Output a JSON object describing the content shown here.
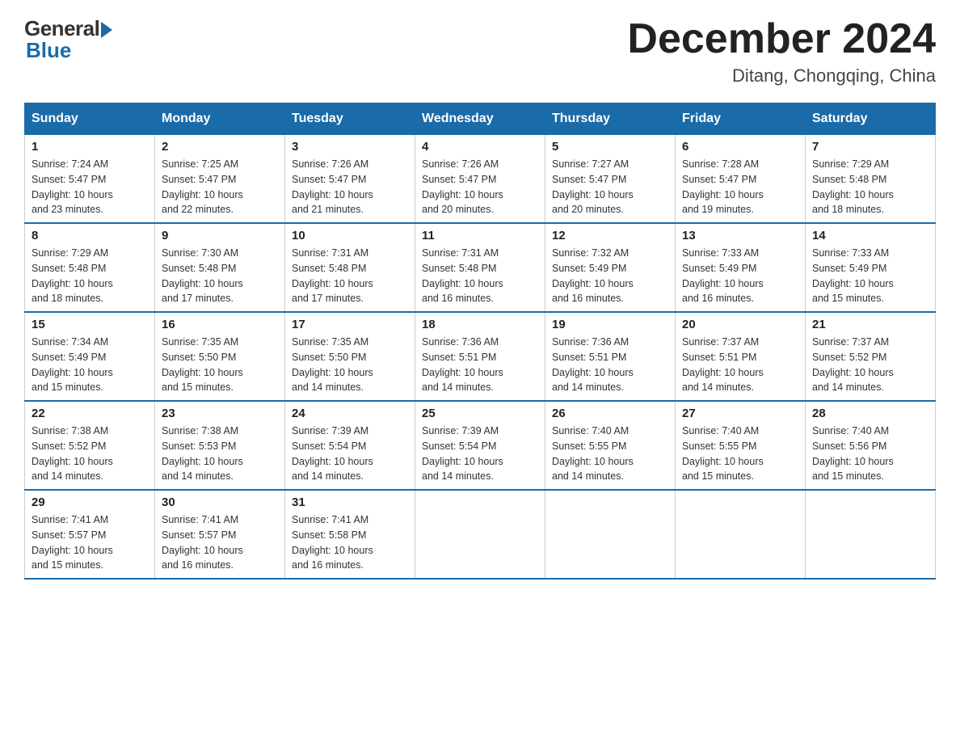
{
  "logo": {
    "general_text": "General",
    "blue_text": "Blue"
  },
  "header": {
    "month_year": "December 2024",
    "location": "Ditang, Chongqing, China"
  },
  "days_of_week": [
    "Sunday",
    "Monday",
    "Tuesday",
    "Wednesday",
    "Thursday",
    "Friday",
    "Saturday"
  ],
  "weeks": [
    [
      {
        "day": "1",
        "sunrise": "7:24 AM",
        "sunset": "5:47 PM",
        "daylight": "10 hours and 23 minutes."
      },
      {
        "day": "2",
        "sunrise": "7:25 AM",
        "sunset": "5:47 PM",
        "daylight": "10 hours and 22 minutes."
      },
      {
        "day": "3",
        "sunrise": "7:26 AM",
        "sunset": "5:47 PM",
        "daylight": "10 hours and 21 minutes."
      },
      {
        "day": "4",
        "sunrise": "7:26 AM",
        "sunset": "5:47 PM",
        "daylight": "10 hours and 20 minutes."
      },
      {
        "day": "5",
        "sunrise": "7:27 AM",
        "sunset": "5:47 PM",
        "daylight": "10 hours and 20 minutes."
      },
      {
        "day": "6",
        "sunrise": "7:28 AM",
        "sunset": "5:47 PM",
        "daylight": "10 hours and 19 minutes."
      },
      {
        "day": "7",
        "sunrise": "7:29 AM",
        "sunset": "5:48 PM",
        "daylight": "10 hours and 18 minutes."
      }
    ],
    [
      {
        "day": "8",
        "sunrise": "7:29 AM",
        "sunset": "5:48 PM",
        "daylight": "10 hours and 18 minutes."
      },
      {
        "day": "9",
        "sunrise": "7:30 AM",
        "sunset": "5:48 PM",
        "daylight": "10 hours and 17 minutes."
      },
      {
        "day": "10",
        "sunrise": "7:31 AM",
        "sunset": "5:48 PM",
        "daylight": "10 hours and 17 minutes."
      },
      {
        "day": "11",
        "sunrise": "7:31 AM",
        "sunset": "5:48 PM",
        "daylight": "10 hours and 16 minutes."
      },
      {
        "day": "12",
        "sunrise": "7:32 AM",
        "sunset": "5:49 PM",
        "daylight": "10 hours and 16 minutes."
      },
      {
        "day": "13",
        "sunrise": "7:33 AM",
        "sunset": "5:49 PM",
        "daylight": "10 hours and 16 minutes."
      },
      {
        "day": "14",
        "sunrise": "7:33 AM",
        "sunset": "5:49 PM",
        "daylight": "10 hours and 15 minutes."
      }
    ],
    [
      {
        "day": "15",
        "sunrise": "7:34 AM",
        "sunset": "5:49 PM",
        "daylight": "10 hours and 15 minutes."
      },
      {
        "day": "16",
        "sunrise": "7:35 AM",
        "sunset": "5:50 PM",
        "daylight": "10 hours and 15 minutes."
      },
      {
        "day": "17",
        "sunrise": "7:35 AM",
        "sunset": "5:50 PM",
        "daylight": "10 hours and 14 minutes."
      },
      {
        "day": "18",
        "sunrise": "7:36 AM",
        "sunset": "5:51 PM",
        "daylight": "10 hours and 14 minutes."
      },
      {
        "day": "19",
        "sunrise": "7:36 AM",
        "sunset": "5:51 PM",
        "daylight": "10 hours and 14 minutes."
      },
      {
        "day": "20",
        "sunrise": "7:37 AM",
        "sunset": "5:51 PM",
        "daylight": "10 hours and 14 minutes."
      },
      {
        "day": "21",
        "sunrise": "7:37 AM",
        "sunset": "5:52 PM",
        "daylight": "10 hours and 14 minutes."
      }
    ],
    [
      {
        "day": "22",
        "sunrise": "7:38 AM",
        "sunset": "5:52 PM",
        "daylight": "10 hours and 14 minutes."
      },
      {
        "day": "23",
        "sunrise": "7:38 AM",
        "sunset": "5:53 PM",
        "daylight": "10 hours and 14 minutes."
      },
      {
        "day": "24",
        "sunrise": "7:39 AM",
        "sunset": "5:54 PM",
        "daylight": "10 hours and 14 minutes."
      },
      {
        "day": "25",
        "sunrise": "7:39 AM",
        "sunset": "5:54 PM",
        "daylight": "10 hours and 14 minutes."
      },
      {
        "day": "26",
        "sunrise": "7:40 AM",
        "sunset": "5:55 PM",
        "daylight": "10 hours and 14 minutes."
      },
      {
        "day": "27",
        "sunrise": "7:40 AM",
        "sunset": "5:55 PM",
        "daylight": "10 hours and 15 minutes."
      },
      {
        "day": "28",
        "sunrise": "7:40 AM",
        "sunset": "5:56 PM",
        "daylight": "10 hours and 15 minutes."
      }
    ],
    [
      {
        "day": "29",
        "sunrise": "7:41 AM",
        "sunset": "5:57 PM",
        "daylight": "10 hours and 15 minutes."
      },
      {
        "day": "30",
        "sunrise": "7:41 AM",
        "sunset": "5:57 PM",
        "daylight": "10 hours and 16 minutes."
      },
      {
        "day": "31",
        "sunrise": "7:41 AM",
        "sunset": "5:58 PM",
        "daylight": "10 hours and 16 minutes."
      },
      null,
      null,
      null,
      null
    ]
  ],
  "labels": {
    "sunrise": "Sunrise:",
    "sunset": "Sunset:",
    "daylight": "Daylight:"
  }
}
